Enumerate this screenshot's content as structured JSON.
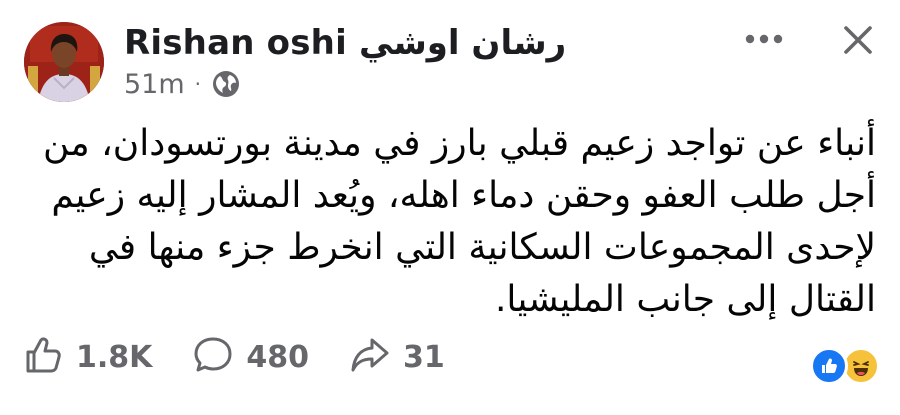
{
  "post": {
    "author": {
      "name": "Rishan oshi رشان اوشي",
      "avatar_icon": "profile-photo"
    },
    "meta": {
      "time": "51m",
      "separator": "·",
      "audience_icon": "globe-icon"
    },
    "header_icons": {
      "more": "more-horizontal-icon",
      "close": "close-icon"
    },
    "body_lines": [
      "أنباء عن تواجد زعيم قبلي بارز في مدينة بورتسودان، من",
      "أجل طلب العفو وحقن دماء اهله، ويُعد المشار إليه  زعيم",
      "لإحدى المجموعات السكانية التي انخرط جزء منها في",
      "القتال إلى جانب المليشيا."
    ],
    "actions": {
      "likes": "1.8K",
      "comments": "480",
      "shares": "31"
    },
    "reactions": [
      "like",
      "haha"
    ]
  },
  "colors": {
    "meta_text": "#65676b",
    "like_blue": "#1877f2",
    "haha_yellow": "#f7c23b"
  }
}
